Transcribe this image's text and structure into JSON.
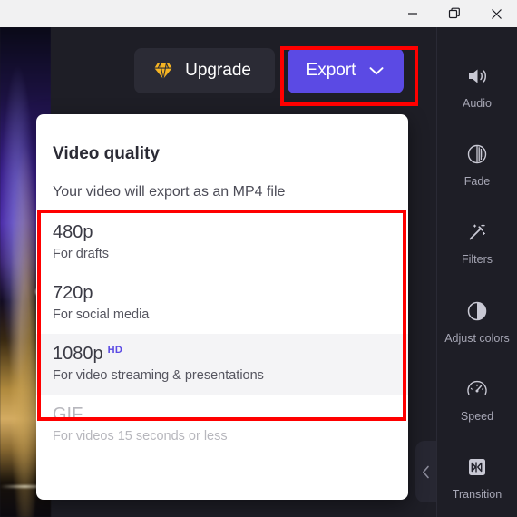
{
  "window": {
    "controls": [
      {
        "name": "minimize",
        "glyph": "minimize-icon",
        "label": "Minimize"
      },
      {
        "name": "restore",
        "glyph": "restore-icon",
        "label": "Restore"
      },
      {
        "name": "close",
        "glyph": "close-icon",
        "label": "Close"
      }
    ]
  },
  "toolbar": {
    "upgrade_label": "Upgrade",
    "upgrade_icon": "gem-icon",
    "export_label": "Export",
    "export_chevron_icon": "chevron-down-icon",
    "export_color": "#5b4ae4",
    "upgrade_bg": "#2b2b35",
    "gem_color": "#f5b423"
  },
  "dropdown": {
    "title": "Video quality",
    "subtitle": "Your video will export as an MP4 file",
    "options": [
      {
        "name": "480p",
        "description": "For drafts",
        "badge": "",
        "selected": false,
        "disabled": false
      },
      {
        "name": "720p",
        "description": "For social media",
        "badge": "",
        "selected": false,
        "disabled": false
      },
      {
        "name": "1080p",
        "description": "For video streaming & presentations",
        "badge": "HD",
        "badge_color": "#5b4ae4",
        "selected": true,
        "disabled": false
      },
      {
        "name": "GIF",
        "description": "For videos 15 seconds or less",
        "badge": "",
        "selected": false,
        "disabled": true
      }
    ]
  },
  "collapse": {
    "icon": "chevron-left-icon"
  },
  "sidebar": {
    "items": [
      {
        "label": "Audio",
        "icon": "speaker-icon"
      },
      {
        "label": "Fade",
        "icon": "fade-circle-icon"
      },
      {
        "label": "Filters",
        "icon": "magic-wand-icon"
      },
      {
        "label": "Adjust colors",
        "icon": "contrast-circle-icon"
      },
      {
        "label": "Speed",
        "icon": "speedometer-icon"
      },
      {
        "label": "Transition",
        "icon": "transition-icon"
      }
    ]
  },
  "annotations": {
    "highlight_color": "#ff0000",
    "boxes": [
      {
        "target": "export-button"
      },
      {
        "target": "video-quality-options"
      }
    ]
  }
}
